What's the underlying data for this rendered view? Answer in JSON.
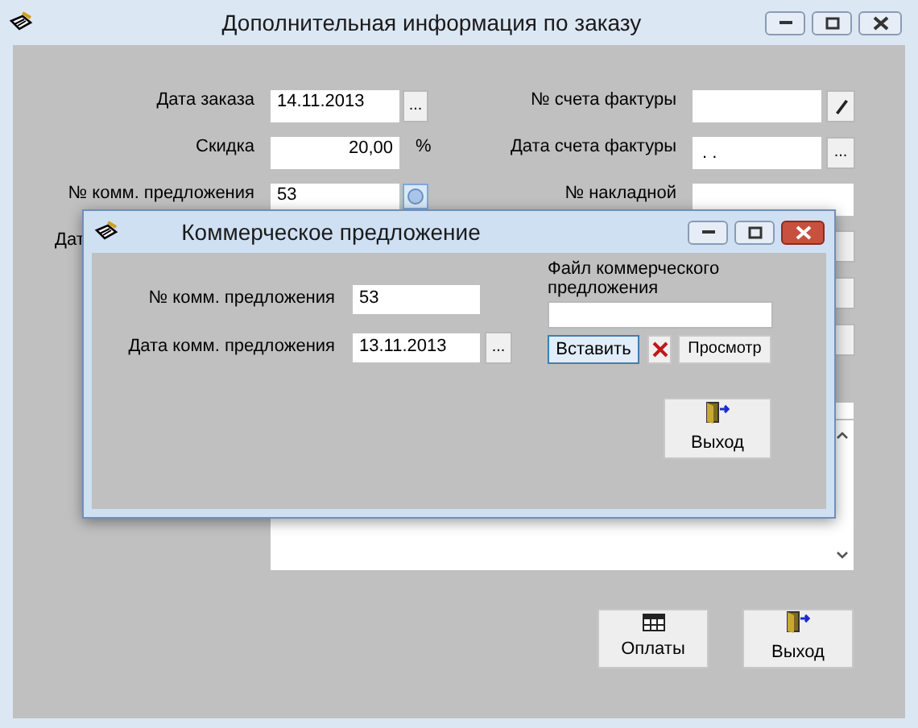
{
  "window": {
    "title": "Дополнительная информация по заказу"
  },
  "left_fields": [
    {
      "label": "Дата заказа",
      "value": "14.11.2013",
      "kind": "date",
      "button": "..."
    },
    {
      "label": "Скидка",
      "value": "20,00",
      "kind": "percent",
      "suffix": "%"
    },
    {
      "label": "№ комм. предложения",
      "value": "53",
      "kind": "link"
    },
    {
      "label": "Дат",
      "kind": "hidden"
    }
  ],
  "right_fields": [
    {
      "label": "№ счета фактуры",
      "kind": "edit"
    },
    {
      "label": "Дата счета фактуры",
      "value": ". .",
      "kind": "date",
      "button": "..."
    },
    {
      "label": "№ накладной",
      "kind": "wide"
    },
    {
      "kind": "partial"
    },
    {
      "kind": "partial"
    },
    {
      "kind": "partial"
    }
  ],
  "footer_buttons": [
    {
      "label": "Оплаты",
      "kind": "table"
    },
    {
      "label": "Выход",
      "kind": "exit"
    }
  ],
  "dialog": {
    "title": "Коммерческое предложение",
    "fields": [
      {
        "label": "№ комм. предложения",
        "value": "53"
      },
      {
        "label": "Дата комм. предложения",
        "value": "13.11.2013",
        "button": "..."
      }
    ],
    "file_label": "Файл коммерческого предложения",
    "insert_button": {
      "label": "Вставить",
      "focused": true
    },
    "view_button": "Просмотр",
    "exit_button": "Выход"
  }
}
